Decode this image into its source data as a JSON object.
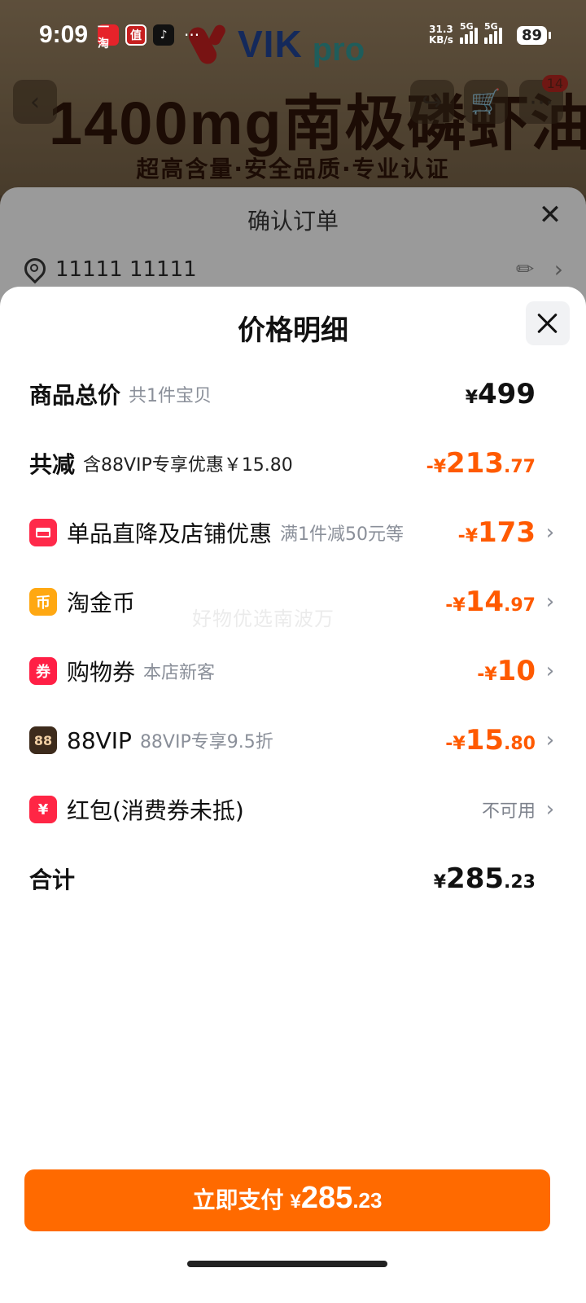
{
  "status_bar": {
    "time": "9:09",
    "app_icons": [
      "taobao-icon",
      "smzdm-icon",
      "douyin-icon"
    ],
    "app_icon_texts": [
      "一淘",
      "值",
      "♪"
    ],
    "overflow": "···",
    "net_speed_value": "31.3",
    "net_speed_unit": "KB/s",
    "signal1_tag": "5G",
    "signal2_tag": "5G",
    "battery": "89"
  },
  "background_page": {
    "logo_vik": "VIK",
    "logo_pro": "pro",
    "headline": "1400mg南极磷虾油",
    "subline": "超高含量·安全品质·专业认证",
    "cart_badge": "14"
  },
  "order_sheet": {
    "title": "确认订单",
    "address": "11111 11111"
  },
  "price_sheet": {
    "title": "价格明细",
    "rows": [
      {
        "label": "商品总价",
        "sub": "共1件宝贝",
        "sign": "¥",
        "int": "499",
        "dec": ""
      },
      {
        "label": "共减",
        "sub": "含88VIP专享优惠￥15.80",
        "sign": "-¥",
        "int": "213",
        "dec": ".77"
      },
      {
        "label": "单品直降及店铺优惠",
        "sub": "满1件减50元等",
        "sign": "-¥",
        "int": "173",
        "dec": ""
      },
      {
        "label": "淘金币",
        "sub": "",
        "sign": "-¥",
        "int": "14",
        "dec": ".97",
        "icon_text": "币"
      },
      {
        "label": "购物券",
        "sub": "本店新客",
        "sign": "-¥",
        "int": "10",
        "dec": "",
        "icon_text": "券"
      },
      {
        "label": "88VIP",
        "sub": "88VIP专享9.5折",
        "sign": "-¥",
        "int": "15",
        "dec": ".80",
        "icon_text": "88"
      },
      {
        "label": "红包(消费券未抵)",
        "sub": "",
        "status": "不可用",
        "icon_text": "¥"
      },
      {
        "label": "合计",
        "sub": "",
        "sign": "¥",
        "int": "285",
        "dec": ".23"
      }
    ],
    "watermark": "好物优选南波万",
    "pay_button": {
      "label": "立即支付",
      "sign": "¥",
      "int": "285",
      "dec": ".23"
    }
  },
  "colors": {
    "accent_orange": "#ff6a00",
    "discount_orange": "#ff5a00",
    "secondary_text": "#8a8f99"
  }
}
